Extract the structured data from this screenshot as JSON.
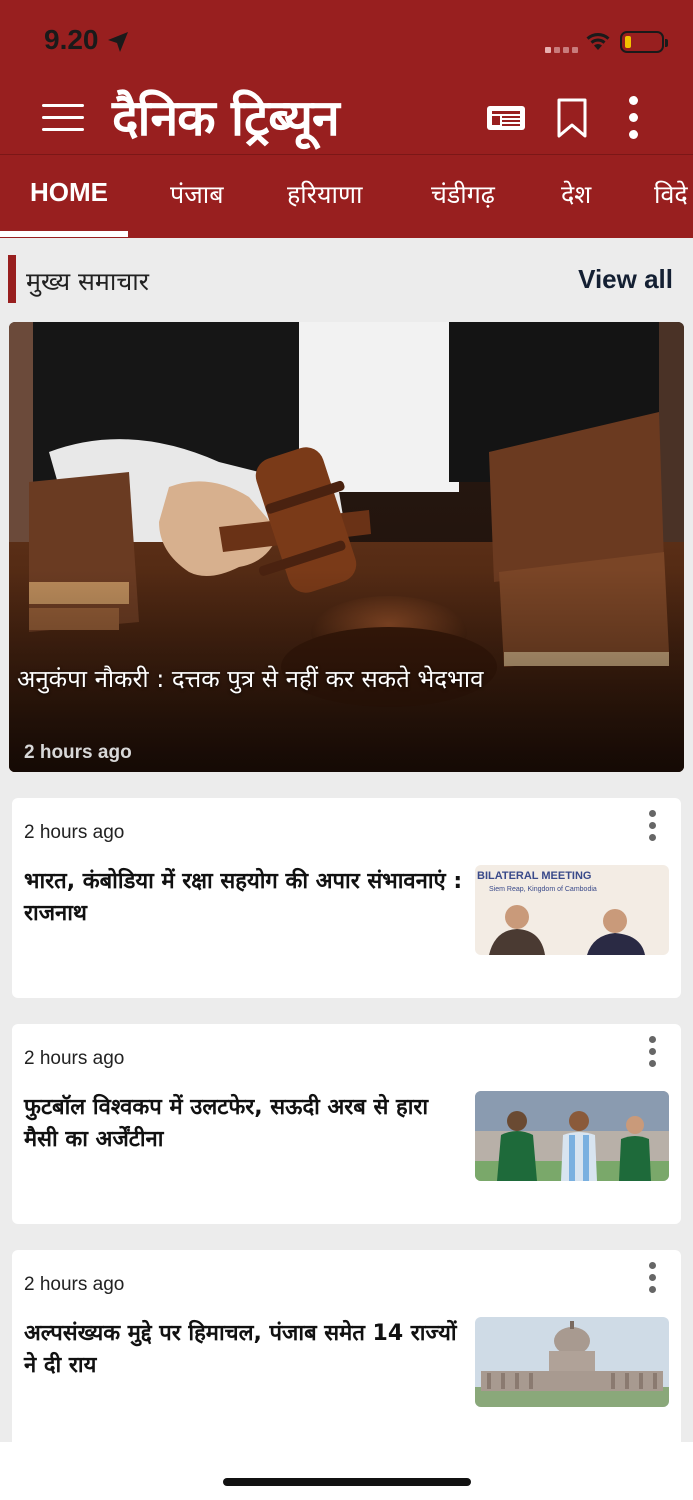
{
  "status_bar": {
    "time": "9.20"
  },
  "header": {
    "logo_text": "दैनिक ट्रिब्यून",
    "brand_color": "#981f1f"
  },
  "tabs": [
    {
      "label": "HOME",
      "active": true
    },
    {
      "label": "पंजाब"
    },
    {
      "label": "हरियाणा"
    },
    {
      "label": "चंडीगढ़"
    },
    {
      "label": "देश"
    },
    {
      "label": "विदे"
    }
  ],
  "section": {
    "title": "मुख्य समाचार",
    "view_all": "View all"
  },
  "hero": {
    "title": "अनुकंपा नौकरी : दत्तक पुत्र से नहीं कर सकते भेदभाव",
    "time": "2 hours ago"
  },
  "articles": [
    {
      "time": "2 hours ago",
      "title": "भारत, कंबोडिया में रक्षा सहयोग की अपार संभावनाएं : राजनाथ",
      "thumb_caption": "BILATERAL MEETING",
      "thumb_subcaption": "Siem Reap, Kingdom of Cambodia"
    },
    {
      "time": "2 hours ago",
      "title": "फुटबॉल विश्वकप में उलटफेर, सऊदी अरब से हारा मैसी का अर्जेंटीना"
    },
    {
      "time": "2 hours ago",
      "title": "अल्पसंख्यक मुद्दे पर हिमाचल, पंजाब समेत 14 राज्यों ने दी राय"
    }
  ],
  "icons": {
    "menu": "hamburger-icon",
    "epaper": "newspaper-icon",
    "bookmark": "bookmark-icon",
    "more": "more-vertical-icon"
  }
}
